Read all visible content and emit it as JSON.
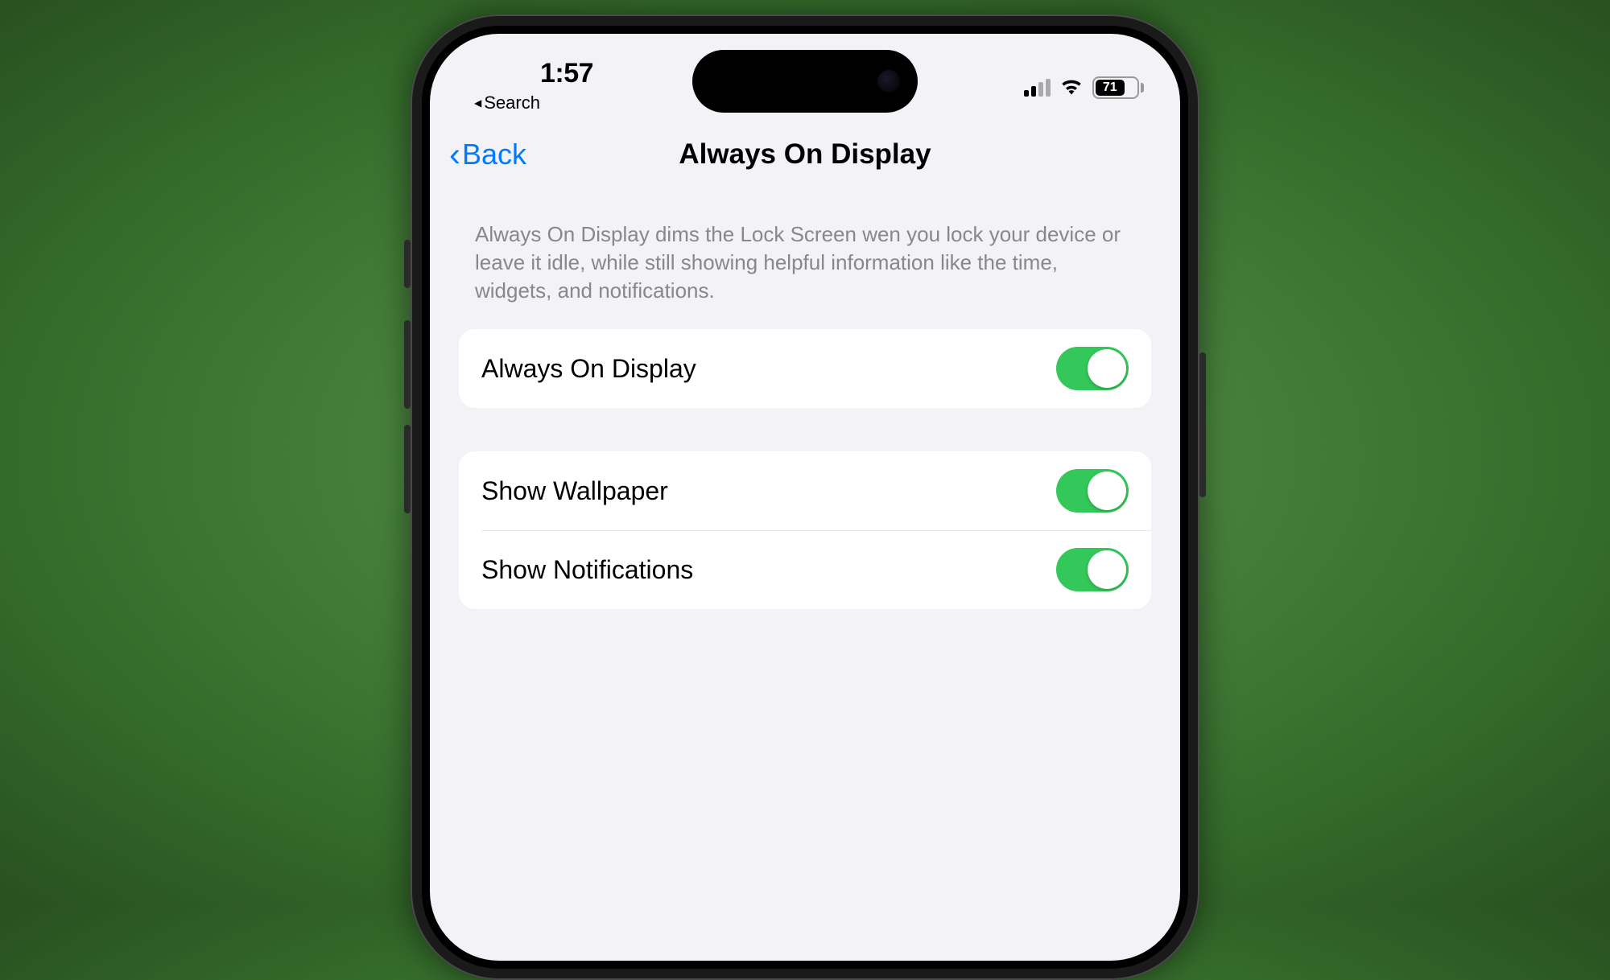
{
  "status": {
    "time": "1:57",
    "search_label": "Search",
    "battery_percent": "71"
  },
  "nav": {
    "back_label": "Back",
    "title": "Always On Display"
  },
  "description": "Always On Display dims the Lock Screen wen you lock your device or leave it idle, while still showing helpful information like the time, widgets, and notifications.",
  "groups": [
    {
      "rows": [
        {
          "label": "Always On Display",
          "on": true
        }
      ]
    },
    {
      "rows": [
        {
          "label": "Show Wallpaper",
          "on": true
        },
        {
          "label": "Show Notifications",
          "on": true
        }
      ]
    }
  ],
  "colors": {
    "accent": "#007aff",
    "toggle_on": "#34c759",
    "bg": "#f2f2f7"
  }
}
